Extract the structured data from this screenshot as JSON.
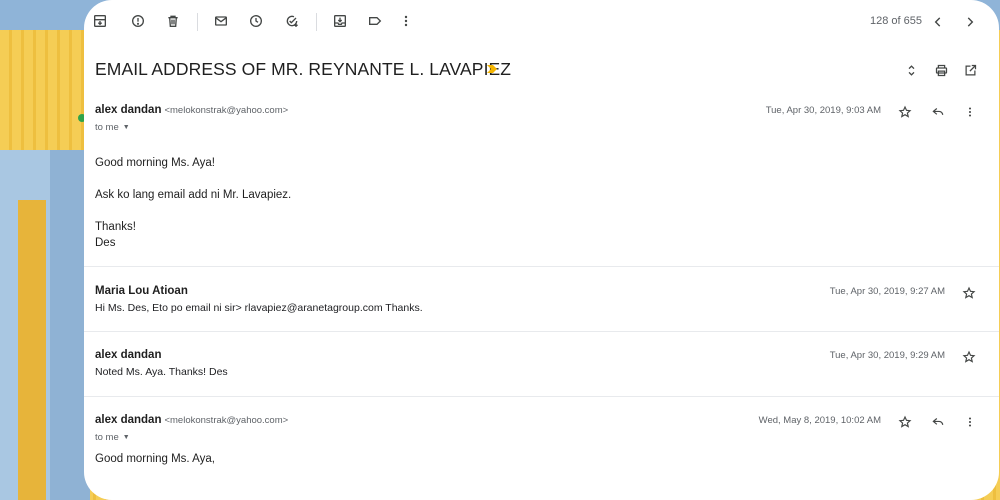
{
  "toolbar": {
    "icons": [
      "archive-icon",
      "report-spam-icon",
      "delete-icon",
      "mark-unread-icon",
      "snooze-icon",
      "add-to-tasks-icon",
      "move-to-icon",
      "label-icon",
      "more-vert-icon"
    ],
    "pager_text": "128 of 655",
    "older_icon": "chevron-left-icon",
    "newer_icon": "chevron-right-icon"
  },
  "thread": {
    "subject": "EMAIL ADDRESS OF MR. REYNANTE L. LAVAPIEZ",
    "importance_color": "#f4b400",
    "actions": [
      "expand-all-icon",
      "print-icon",
      "open-new-window-icon"
    ]
  },
  "messages": [
    {
      "sender": "alex dandan",
      "email": "<melokonstrak@yahoo.com>",
      "recipient": "to me",
      "date": "Tue, Apr 30, 2019, 9:03 AM",
      "body": [
        "Good morning Ms. Aya!",
        "Ask ko lang email add ni Mr. Lavapiez.",
        "Thanks!",
        "Des"
      ]
    },
    {
      "sender": "Maria Lou Atioan",
      "date": "Tue, Apr 30, 2019, 9:27 AM",
      "snippet": "Hi Ms. Des, Eto po email ni sir> rlavapiez@aranetagroup.com Thanks."
    },
    {
      "sender": "alex dandan",
      "date": "Tue, Apr 30, 2019, 9:29 AM",
      "snippet": "Noted Ms. Aya. Thanks! Des"
    },
    {
      "sender": "alex dandan",
      "email": "<melokonstrak@yahoo.com>",
      "recipient": "to me",
      "date": "Wed, May 8, 2019, 10:02 AM",
      "body": [
        "Good morning Ms. Aya,"
      ]
    }
  ],
  "colors": {
    "accent_star": "#444746",
    "background_yellow": "#f5cd55",
    "background_blue": "#a9c7e2"
  }
}
